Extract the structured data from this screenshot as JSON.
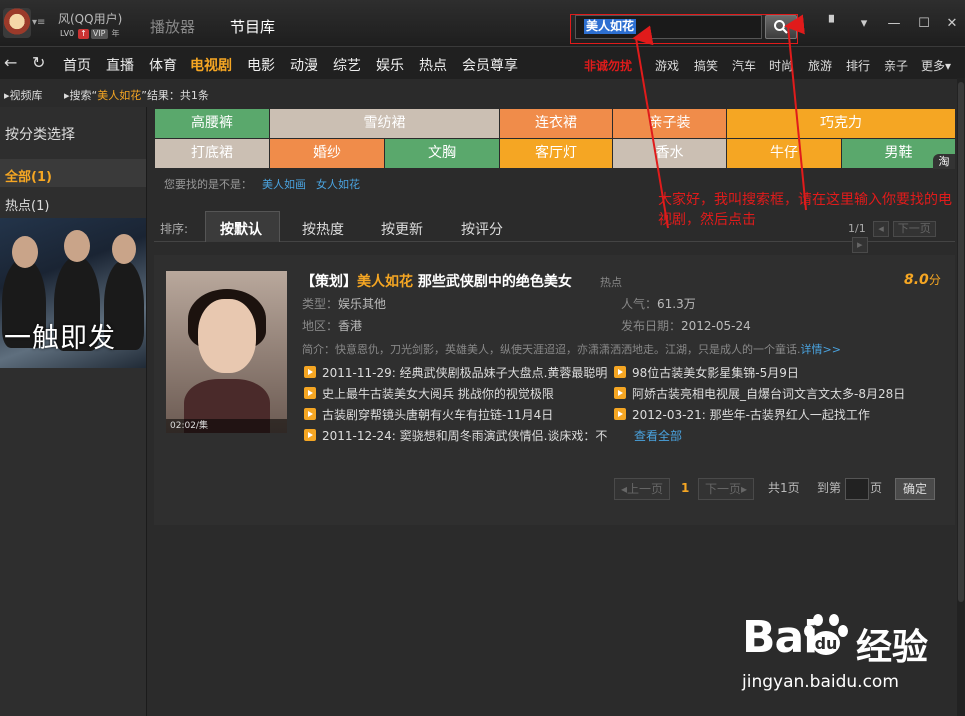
{
  "topbar": {
    "username": "风(QQ用户)",
    "badges": {
      "level": "LV0",
      "vip": "VIP",
      "year": "年"
    },
    "tabs": [
      "播放器",
      "节目库"
    ],
    "search_value": "美人如花"
  },
  "nav": {
    "main": [
      "首页",
      "直播",
      "体育",
      "电视剧",
      "电影",
      "动漫",
      "综艺",
      "娱乐",
      "热点",
      "会员尊享"
    ],
    "promo": "非诚勿扰",
    "right": [
      "游戏",
      "搞笑",
      "汽车",
      "时尚",
      "旅游",
      "排行",
      "亲子",
      "更多"
    ]
  },
  "breadcrumb": {
    "root": "视频库",
    "prefix": "搜索",
    "query": "美人如花",
    "suffix": "结果：共1条"
  },
  "sidebar": {
    "title": "按分类选择",
    "all": "全部(1)",
    "hot": "热点(1)",
    "poster_title": "一触即发"
  },
  "tags": [
    {
      "label": "高腰裤",
      "color": "#5aa86c"
    },
    {
      "label": "雪纺裙",
      "color": "#cbbfb3"
    },
    {
      "label": "连衣裙",
      "color": "#f08c4a"
    },
    {
      "label": "亲子装",
      "color": "#f08c4a"
    },
    {
      "label": "巧克力",
      "color": "#f5a623"
    },
    {
      "label": "打底裙",
      "color": "#cbbfb3"
    },
    {
      "label": "婚纱",
      "color": "#f08c4a"
    },
    {
      "label": "文胸",
      "color": "#5aa86c"
    },
    {
      "label": "客厅灯",
      "color": "#f5a623"
    },
    {
      "label": "香水",
      "color": "#cbbfb3"
    },
    {
      "label": "牛仔",
      "color": "#f5a623"
    },
    {
      "label": "男鞋",
      "color": "#5aa86c"
    }
  ],
  "tag_corner": "淘",
  "suggest": {
    "label": "您要找的是不是：",
    "links": [
      "美人如画",
      "女人如花"
    ]
  },
  "sort": {
    "label": "排序:",
    "tabs": [
      "按默认",
      "按热度",
      "按更新",
      "按评分"
    ],
    "page_info": "1/1",
    "next": "下一页"
  },
  "result": {
    "prefix": "【策划】",
    "highlight": "美人如花",
    "title_rest": " 那些武侠剧中的绝色美女",
    "tag": "热点",
    "score": "8.0",
    "score_unit": "分",
    "duration": "02:02/集",
    "type_label": "类型：",
    "type": "娱乐其他",
    "region_label": "地区：",
    "region": "香港",
    "pop_label": "人气：",
    "popularity": "61.3万",
    "date_label": "发布日期：",
    "date": "2012-05-24",
    "synopsis": "简介：快意恩仇，刀光剑影，英雄美人，纵使天涯迢迢，亦潇潇洒洒地走。江湖，只是成人的一个童话.",
    "more": "详情>>",
    "episodes_left": [
      "2011-11-29: 经典武侠剧极品妹子大盘点.黄蓉最聪明",
      "史上最牛古装美女大阅兵 挑战你的视觉极限",
      "古装剧穿帮镜头唐朝有火车有拉链-11月4日",
      "2011-12-24: 窦骁想和周冬雨演武侠情侣.谈床戏：不"
    ],
    "episodes_right": [
      "98位古装美女影星集锦-5月9日",
      "阿娇古装亮相电视展_自爆台词文言文太多-8月28日",
      "2012-03-21: 那些年-古装界红人一起找工作"
    ],
    "view_all": "查看全部"
  },
  "pager": {
    "prev": "上一页",
    "current": "1",
    "next": "下一页",
    "total": "共1页",
    "goto": "到第",
    "page_unit": "页",
    "confirm": "确定"
  },
  "annotation": "大家好，我叫搜索框，请在这里输入你要找的电视剧，然后点击",
  "watermark": {
    "logo": "Bai",
    "brand": "经验",
    "url": "jingyan.baidu.com"
  }
}
